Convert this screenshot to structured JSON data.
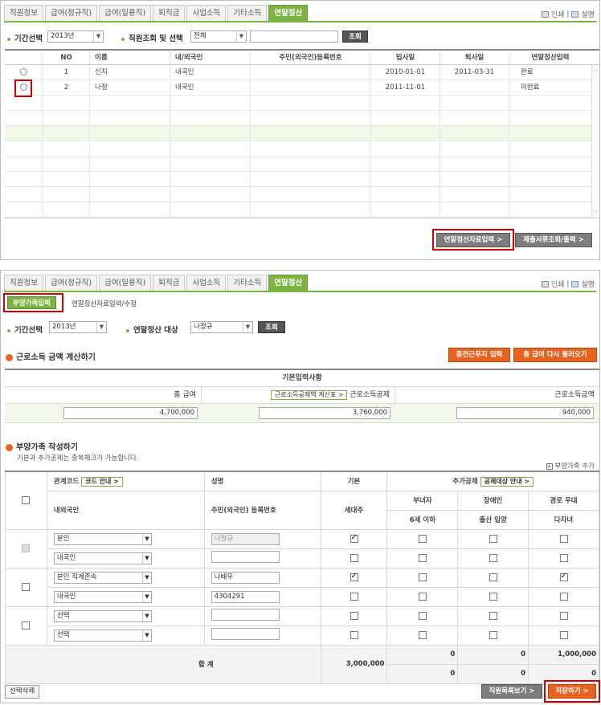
{
  "tabs": [
    "직원정보",
    "급여(정규직)",
    "급여(일용직)",
    "퇴직금",
    "사업소득",
    "기타소득",
    "연말정산"
  ],
  "top_links": {
    "print": "인쇄",
    "help": "설명"
  },
  "panel1": {
    "period_label": "기간선택",
    "period_value": "2013년",
    "search_label": "직원조회 및 선택",
    "search_filter": "전체",
    "search_input": "",
    "search_button": "조회",
    "columns": [
      "NO",
      "이름",
      "내/외국인",
      "주민(외국인)등록번호",
      "입사일",
      "퇴사일",
      "연말정산입력"
    ],
    "rows": [
      {
        "no": "1",
        "name": "신지",
        "nat": "내국인",
        "id": "",
        "join": "2010-01-01",
        "leave": "2011-03-31",
        "status": "완료"
      },
      {
        "no": "2",
        "name": "나정",
        "nat": "내국인",
        "id": "",
        "join": "2011-11-01",
        "leave": "",
        "status": "미완료"
      }
    ],
    "btn_input": "연말정산자료입력 >",
    "btn_submit": "제출서류조회/출력 >"
  },
  "panel2": {
    "subtab_active": "부양가족입력",
    "subtab_other": "연말정산자료입력/수정",
    "period_label": "기간선택",
    "period_value": "2013년",
    "target_label": "연말정산 대상",
    "target_value": "나정규",
    "search_button": "조회",
    "section1_title": "근로소득 금액 계산하기",
    "btn_prev_work": "종전근무지 입력",
    "btn_reload_pay": "총 급여 다시 불러오기",
    "basic_header": "기본입력사항",
    "total_pay_label": "총 급여",
    "deduction_table_btn": "근로소득공제액 계산표 >",
    "deduction_label": "근로소득공제",
    "earned_income_label": "근로소득금액",
    "total_pay_value": "4,700,000",
    "deduction_value": "3,760,000",
    "earned_income_value": "940,000",
    "section2_title": "부양가족 작성하기",
    "section2_note": "기본과 추가공제는 중복체크가 가능합니다.",
    "add_dependent": "부양가족 추가",
    "hdr_relation": "관계코드",
    "btn_code_guide": "코드 안내 >",
    "hdr_name": "성명",
    "hdr_basic": "기본",
    "hdr_extra": "추가공제",
    "btn_extra_guide": "공제대상 안내 >",
    "hdr_nat": "내외국인",
    "hdr_id": "주민(외국인) 등록번호",
    "hdr_householder": "세대주",
    "hdr_woman": "부녀자",
    "hdr_under6": "6세 이하",
    "hdr_disabled": "장애인",
    "hdr_birth": "출산 입양",
    "hdr_elder": "경로 우대",
    "hdr_multi": "다자녀",
    "dependents": [
      {
        "relation": "본인",
        "nat": "내국인",
        "name": "나정규",
        "id": "",
        "basic": true,
        "woman": false,
        "disabled": false,
        "elder": false,
        "u6": false,
        "birth": false,
        "multi": false
      },
      {
        "relation": "본인 직계존속",
        "nat": "내국인",
        "name": "나배우",
        "id": "4304291",
        "basic": true,
        "woman": false,
        "disabled": false,
        "elder": true,
        "u6": false,
        "birth": false,
        "multi": false
      },
      {
        "relation": "선택",
        "nat": "선택",
        "name": "",
        "id": "",
        "basic": false,
        "woman": false,
        "disabled": false,
        "elder": false,
        "u6": false,
        "birth": false,
        "multi": false
      }
    ],
    "sum_label": "합 계",
    "sum_basic": "3,000,000",
    "sum_woman": "0",
    "sum_disabled": "0",
    "sum_elder": "1,000,000",
    "sum_u6": "0",
    "sum_birth": "0",
    "sum_multi": "0",
    "btn_delete": "선택삭제",
    "btn_list": "직원목록보기 >",
    "btn_save": "저장하기 >"
  },
  "colors": {
    "accent": "#7cb342",
    "orange": "#e8631f",
    "highlight": "#d10000"
  }
}
